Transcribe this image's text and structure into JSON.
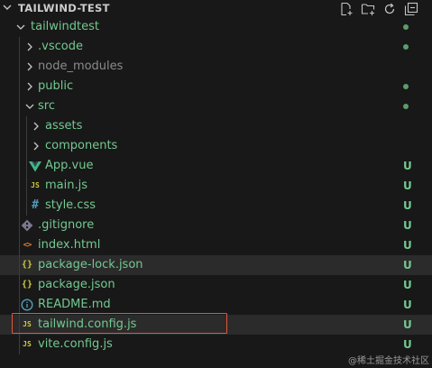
{
  "explorer": {
    "title": "TAILWIND-TEST",
    "actions": [
      {
        "name": "new-file-icon"
      },
      {
        "name": "new-folder-icon"
      },
      {
        "name": "refresh-icon"
      },
      {
        "name": "collapse-all-icon"
      }
    ]
  },
  "tree": [
    {
      "label": "tailwindtest",
      "type": "folder",
      "expanded": true,
      "status": "dot",
      "color": "green"
    },
    {
      "label": ".vscode",
      "type": "folder",
      "expanded": false,
      "status": "dot",
      "color": "green"
    },
    {
      "label": "node_modules",
      "type": "folder",
      "expanded": false,
      "status": "",
      "color": "dim"
    },
    {
      "label": "public",
      "type": "folder",
      "expanded": false,
      "status": "dot",
      "color": "green"
    },
    {
      "label": "src",
      "type": "folder",
      "expanded": true,
      "status": "dot",
      "color": "green"
    },
    {
      "label": "assets",
      "type": "folder",
      "expanded": false,
      "status": "",
      "color": "green"
    },
    {
      "label": "components",
      "type": "folder",
      "expanded": false,
      "status": "",
      "color": "green"
    },
    {
      "label": "App.vue",
      "type": "file",
      "icon": "vue-icon",
      "status": "U",
      "color": "green"
    },
    {
      "label": "main.js",
      "type": "file",
      "icon": "js-icon",
      "status": "U",
      "color": "green"
    },
    {
      "label": "style.css",
      "type": "file",
      "icon": "css-icon",
      "status": "U",
      "color": "green"
    },
    {
      "label": ".gitignore",
      "type": "file",
      "icon": "git-icon",
      "status": "U",
      "color": "green"
    },
    {
      "label": "index.html",
      "type": "file",
      "icon": "html-icon",
      "status": "U",
      "color": "green"
    },
    {
      "label": "package-lock.json",
      "type": "file",
      "icon": "json-icon",
      "status": "U",
      "color": "green",
      "hover": true
    },
    {
      "label": "package.json",
      "type": "file",
      "icon": "json-icon",
      "status": "U",
      "color": "green"
    },
    {
      "label": "README.md",
      "type": "file",
      "icon": "info-icon",
      "status": "U",
      "color": "green"
    },
    {
      "label": "tailwind.config.js",
      "type": "file",
      "icon": "js-icon",
      "status": "U",
      "color": "green",
      "hover": true,
      "highlighted": true
    },
    {
      "label": "vite.config.js",
      "type": "file",
      "icon": "js-icon",
      "status": "U",
      "color": "green"
    }
  ],
  "watermark": "@稀土掘金技术社区",
  "colors": {
    "background": "#181818",
    "git_untracked": "#73c991",
    "highlight_box": "#e5553a",
    "vue": "#41b883",
    "js": "#cbcb41",
    "css": "#519aba",
    "html": "#e37933",
    "info": "#519aba",
    "git": "#7a7a8c"
  }
}
